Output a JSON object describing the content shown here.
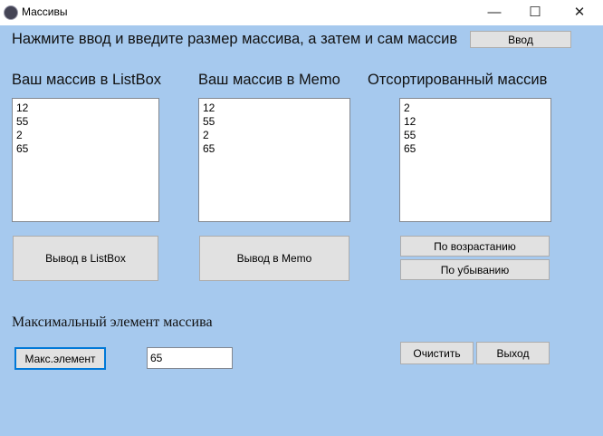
{
  "window": {
    "title": "Массивы",
    "minimize": "—",
    "maximize": "☐",
    "close": "✕"
  },
  "header": {
    "instruction": "Нажмите ввод и введите размер массива, а затем и сам массив",
    "enter_button": "Ввод"
  },
  "listbox": {
    "label": "Ваш массив в ListBox",
    "items": [
      "12",
      "55",
      "2",
      "65"
    ],
    "button": "Вывод в ListBox"
  },
  "memo": {
    "label": "Ваш массив в Memo",
    "items": [
      "12",
      "55",
      "2",
      "65"
    ],
    "button": "Вывод в Memo"
  },
  "sorted": {
    "label": "Отсортированный массив",
    "items": [
      "2",
      "12",
      "55",
      "65"
    ],
    "asc_button": "По возрастанию",
    "desc_button": "По убыванию"
  },
  "max": {
    "label": "Максимальный элемент массива",
    "button": "Макс.элемент",
    "value": "65"
  },
  "clear_button": "Очистить",
  "exit_button": "Выход"
}
